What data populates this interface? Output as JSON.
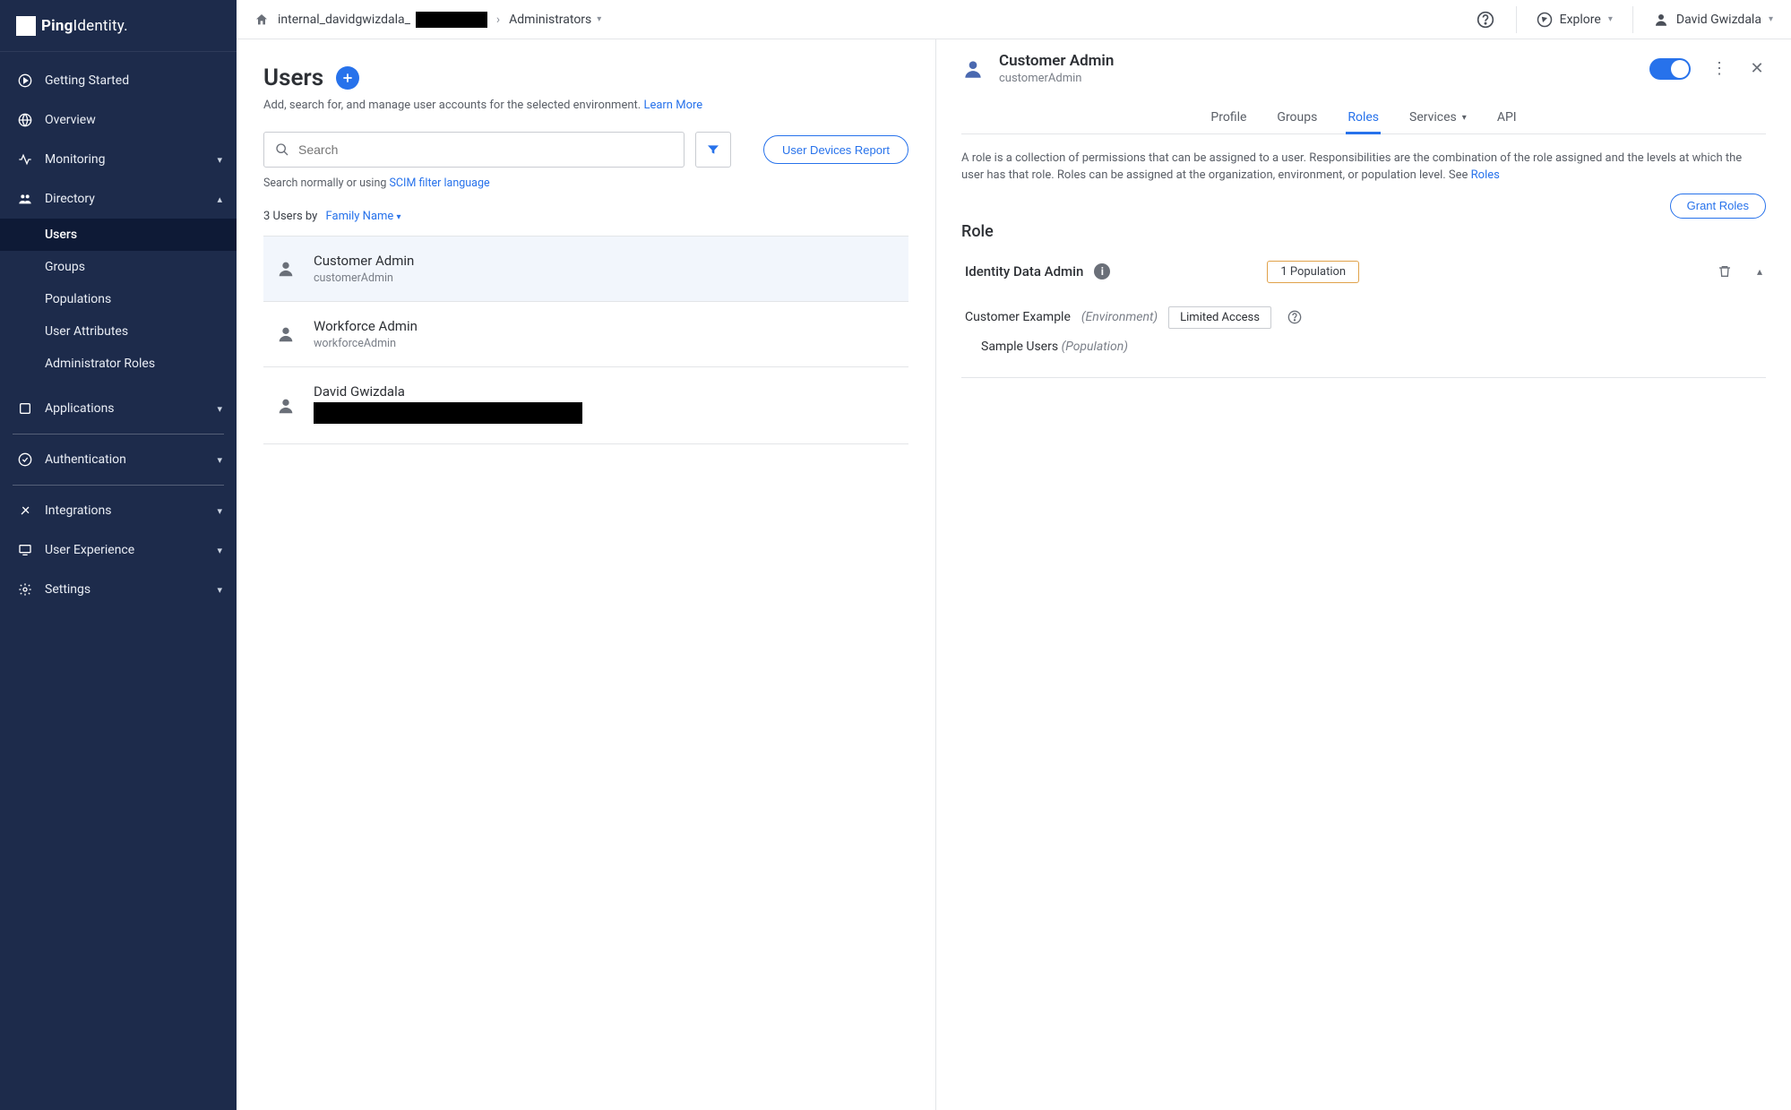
{
  "brand": {
    "name_bold": "Ping",
    "name_rest": "Identity."
  },
  "sidebar": {
    "items": [
      {
        "label": "Getting Started",
        "icon": "play"
      },
      {
        "label": "Overview",
        "icon": "globe"
      },
      {
        "label": "Monitoring",
        "icon": "pulse",
        "chev": true
      },
      {
        "label": "Directory",
        "icon": "people",
        "chev_up": true
      },
      {
        "label": "Applications",
        "icon": "app",
        "chev": true
      },
      {
        "label": "Authentication",
        "icon": "check",
        "chev": true
      },
      {
        "label": "Integrations",
        "icon": "plug",
        "chev": true
      },
      {
        "label": "User Experience",
        "icon": "screen",
        "chev": true
      },
      {
        "label": "Settings",
        "icon": "gear",
        "chev": true
      }
    ],
    "directory_sub": [
      {
        "label": "Users",
        "active": true
      },
      {
        "label": "Groups"
      },
      {
        "label": "Populations"
      },
      {
        "label": "User Attributes"
      },
      {
        "label": "Administrator Roles"
      }
    ]
  },
  "topbar": {
    "env_prefix": "internal_davidgwizdala_",
    "crumb2": "Administrators",
    "explore": "Explore",
    "user": "David Gwizdala"
  },
  "page": {
    "title": "Users",
    "subtitle": "Add, search for, and manage user accounts for the selected environment. ",
    "learn_more": "Learn More",
    "search_placeholder": "Search",
    "search_hint_pre": "Search normally or using ",
    "search_hint_link": "SCIM filter language",
    "report_btn": "User Devices Report",
    "sort_label": "3 Users by",
    "sort_value": "Family Name"
  },
  "users": [
    {
      "name": "Customer Admin",
      "id": "customerAdmin",
      "selected": true
    },
    {
      "name": "Workforce Admin",
      "id": "workforceAdmin"
    },
    {
      "name": "David Gwizdala",
      "id_redacted": true
    }
  ],
  "detail": {
    "title": "Customer Admin",
    "subtitle": "customerAdmin",
    "tabs": [
      {
        "label": "Profile"
      },
      {
        "label": "Groups"
      },
      {
        "label": "Roles",
        "active": true
      },
      {
        "label": "Services",
        "chev": true
      },
      {
        "label": "API"
      }
    ],
    "help": "A role is a collection of permissions that can be assigned to a user. Responsibilities are the combination of the role assigned and the levels at which the user has that role. Roles can be assigned at the organization, environment, or population level. See ",
    "help_link": "Roles",
    "grant_btn": "Grant Roles",
    "section_title": "Role",
    "role_name": "Identity Data Admin",
    "pop_badge": "1 Population",
    "scope_env": "Customer Example",
    "scope_env_type": "(Environment)",
    "limited": "Limited Access",
    "scope_pop": "Sample Users",
    "scope_pop_type": "(Population)"
  }
}
